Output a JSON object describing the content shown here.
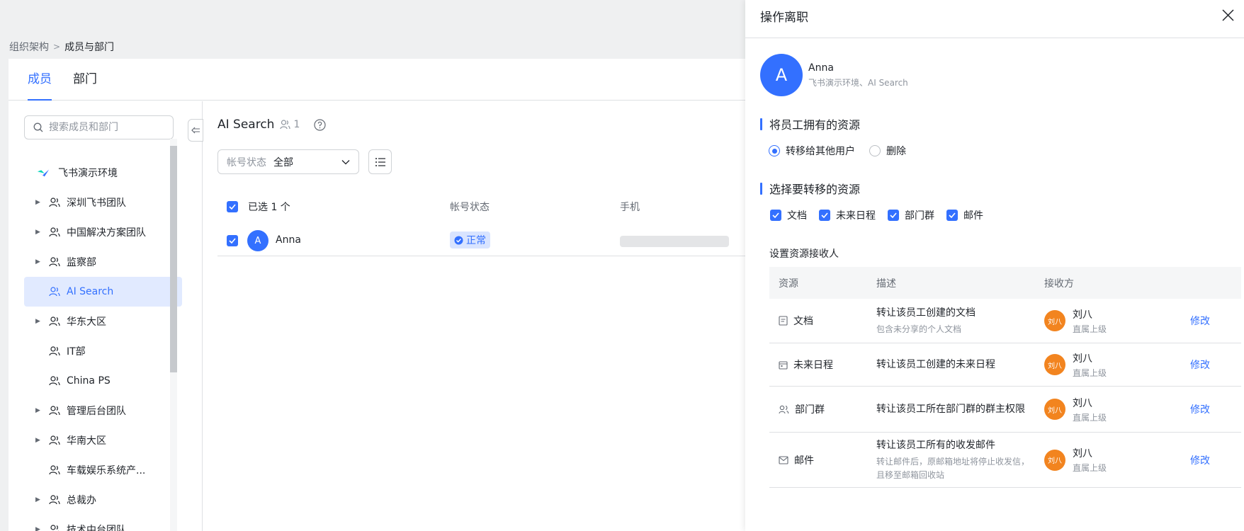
{
  "breadcrumb": {
    "root": "组织架构",
    "current": "成员与部门"
  },
  "tabs": [
    {
      "label": "成员",
      "active": true
    },
    {
      "label": "部门",
      "active": false
    }
  ],
  "sidebar": {
    "search_placeholder": "搜索成员和部门",
    "root": "飞书演示环境",
    "items": [
      {
        "label": "深圳飞书团队",
        "expandable": true
      },
      {
        "label": "中国解决方案团队",
        "expandable": true
      },
      {
        "label": "监察部",
        "expandable": true
      },
      {
        "label": "AI Search",
        "expandable": false,
        "selected": true
      },
      {
        "label": "华东大区",
        "expandable": true
      },
      {
        "label": "IT部",
        "expandable": false
      },
      {
        "label": "China PS",
        "expandable": false
      },
      {
        "label": "管理后台团队",
        "expandable": true
      },
      {
        "label": "华南大区",
        "expandable": true
      },
      {
        "label": "车载娱乐系统产...",
        "expandable": false
      },
      {
        "label": "总裁办",
        "expandable": true
      },
      {
        "label": "技术中台团队",
        "expandable": true
      }
    ]
  },
  "content": {
    "title": "AI Search",
    "member_count": "1",
    "filter": {
      "key": "帐号状态",
      "value": "全部"
    },
    "table": {
      "selected_label": "已选 1 个",
      "col_status": "帐号状态",
      "col_phone": "手机",
      "row": {
        "avatar": "A",
        "name": "Anna",
        "status": "正常"
      }
    }
  },
  "drawer": {
    "title": "操作离职",
    "person": {
      "avatar": "A",
      "name": "Anna",
      "desc": "飞书演示环境、AI Search"
    },
    "section1": "将员工拥有的资源",
    "radio_transfer": "转移给其他用户",
    "radio_delete": "删除",
    "section2": "选择要转移的资源",
    "checks": [
      "文档",
      "未来日程",
      "部门群",
      "邮件"
    ],
    "receiver_label": "设置资源接收人",
    "table_headers": {
      "resource": "资源",
      "desc": "描述",
      "receiver": "接收方"
    },
    "rows": [
      {
        "icon": "doc-icon",
        "resource": "文档",
        "desc": "转让该员工创建的文档",
        "sub": "包含未分享的个人文档",
        "avatar": "刘八",
        "receiver": "刘八",
        "role": "直属上级",
        "action": "修改"
      },
      {
        "icon": "calendar-icon",
        "resource": "未来日程",
        "desc": "转让该员工创建的未来日程",
        "sub": "",
        "avatar": "刘八",
        "receiver": "刘八",
        "role": "直属上级",
        "action": "修改"
      },
      {
        "icon": "group-icon",
        "resource": "部门群",
        "desc": "转让该员工所在部门群的群主权限",
        "sub": "",
        "avatar": "刘八",
        "receiver": "刘八",
        "role": "直属上级",
        "action": "修改"
      },
      {
        "icon": "mail-icon",
        "resource": "邮件",
        "desc": "转让该员工所有的收发邮件",
        "sub": "转让邮件后，原邮箱地址将停止收发信，且移至邮箱回收站",
        "avatar": "刘八",
        "receiver": "刘八",
        "role": "直属上级",
        "action": "修改"
      }
    ]
  },
  "colors": {
    "accent": "#3370ff",
    "receiver_avatar": "#f2841f"
  }
}
